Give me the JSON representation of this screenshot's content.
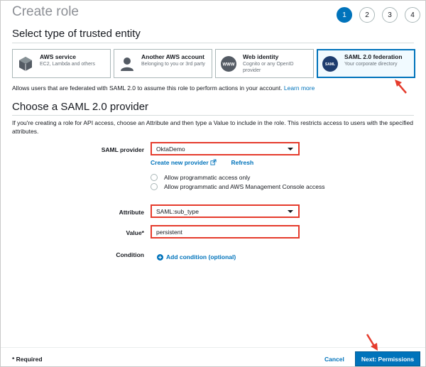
{
  "page": {
    "title": "Create role"
  },
  "steps": [
    "1",
    "2",
    "3",
    "4"
  ],
  "section1": {
    "heading": "Select type of trusted entity",
    "cards": [
      {
        "title": "AWS service",
        "subtitle": "EC2, Lambda and others",
        "icon": "cube-icon"
      },
      {
        "title": "Another AWS account",
        "subtitle": "Belonging to you or 3rd party",
        "icon": "user-icon"
      },
      {
        "title": "Web identity",
        "subtitle": "Cognito or any OpenID provider",
        "icon": "www-icon"
      },
      {
        "title": "SAML 2.0 federation",
        "subtitle": "Your corporate directory",
        "icon": "saml-icon",
        "selected": true
      }
    ],
    "description": "Allows users that are federated with SAML 2.0 to assume this role to perform actions in your account.",
    "learn_more": "Learn more"
  },
  "section2": {
    "heading": "Choose a SAML 2.0 provider",
    "description": "If you're creating a role for API access, choose an Attribute and then type a Value to include in the role. This restricts access to users with the specified attributes.",
    "saml_provider_label": "SAML provider",
    "saml_provider_value": "OktaDemo",
    "create_provider": "Create new provider",
    "refresh": "Refresh",
    "radio_programmatic": "Allow programmatic access only",
    "radio_console": "Allow programmatic and AWS Management Console access",
    "attribute_label": "Attribute",
    "attribute_value": "SAML:sub_type",
    "value_label": "Value*",
    "value_value": "persistent",
    "condition_label": "Condition",
    "add_condition": "Add condition (optional)"
  },
  "footer": {
    "required": "* Required",
    "cancel": "Cancel",
    "next": "Next: Permissions"
  },
  "colors": {
    "accent": "#0073bb",
    "highlight": "#e53b2c"
  }
}
